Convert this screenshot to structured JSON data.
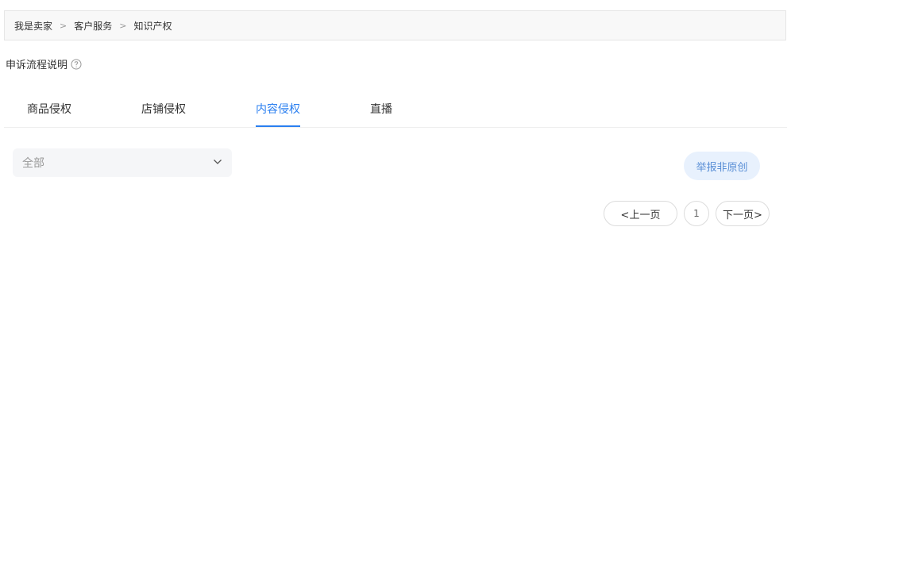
{
  "breadcrumb": {
    "items": [
      "我是卖家",
      "客户服务",
      "知识产权"
    ],
    "separator": ">"
  },
  "appeal": {
    "label": "申诉流程说明",
    "help_icon": "help-circle-icon"
  },
  "tabs": [
    {
      "label": "商品侵权",
      "active": false
    },
    {
      "label": "店铺侵权",
      "active": false
    },
    {
      "label": "内容侵权",
      "active": true
    },
    {
      "label": "直播",
      "active": false
    }
  ],
  "filter": {
    "selected": "全部",
    "icon": "chevron-down-icon"
  },
  "actions": {
    "report_label": "举报非原创"
  },
  "pagination": {
    "prev_label": "<上一页",
    "current_page": "1",
    "next_label": "下一页>"
  },
  "colors": {
    "accent": "#2a7ff0",
    "button_bg": "#e8f1fd",
    "button_text": "#5a8fd6"
  }
}
